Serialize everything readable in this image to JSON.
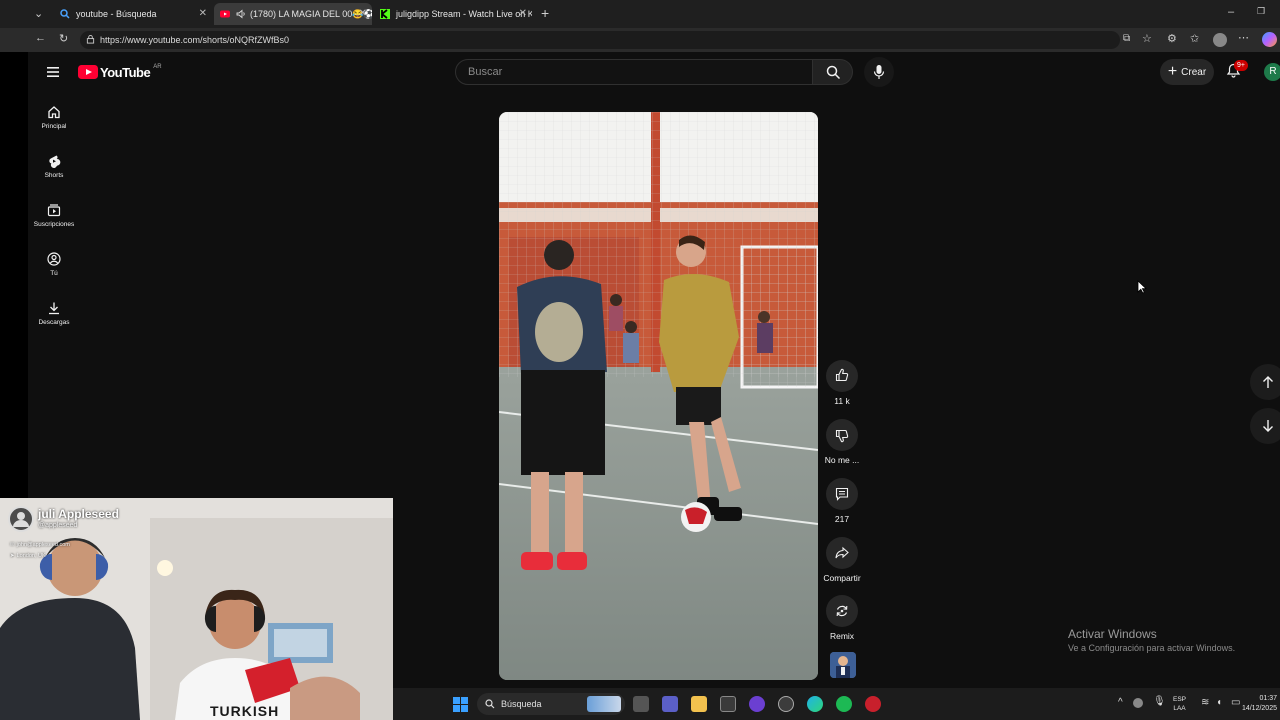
{
  "browser": {
    "tabs": [
      {
        "title": "youtube - Búsqueda"
      },
      {
        "title": "(1780) LA MAGIA DEL 00😂⚽ #"
      },
      {
        "title": "juligdipp Stream - Watch Live on K"
      }
    ],
    "url": "https://www.youtube.com/shorts/oNQRfZWfBs0"
  },
  "youtube": {
    "logo_text": "YouTube",
    "country_code": "AR",
    "search_placeholder": "Buscar",
    "create_label": "Crear",
    "notif_badge": "9+",
    "avatar_letter": "R",
    "sidebar": [
      {
        "label": "Principal",
        "icon": "home-icon"
      },
      {
        "label": "Shorts",
        "icon": "shorts-icon"
      },
      {
        "label": "Suscripciones",
        "icon": "subscriptions-icon"
      },
      {
        "label": "Tú",
        "icon": "you-icon"
      },
      {
        "label": "Descargas",
        "icon": "download-icon"
      }
    ],
    "actions": {
      "like_count": "11 k",
      "dislike_label": "No me ...",
      "comments_count": "217",
      "share_label": "Compartir",
      "remix_label": "Remix"
    }
  },
  "webcam": {
    "name": "juli Appleseed",
    "handle": "@appleseed",
    "email": "john@appleseed.com",
    "location": "London, UK",
    "shirt_text": "TURKISH"
  },
  "windows": {
    "activate_title": "Activar Windows",
    "activate_sub": "Ve a Configuración para activar Windows.",
    "taskbar_search": "Búsqueda",
    "lang_top": "ESP",
    "lang_bottom": "LAA",
    "time": "01:37",
    "date": "14/12/2025"
  },
  "colors": {
    "yt_red": "#ff0033",
    "bg": "#0f0f0f",
    "jersey_gold": "#b99b3e"
  }
}
